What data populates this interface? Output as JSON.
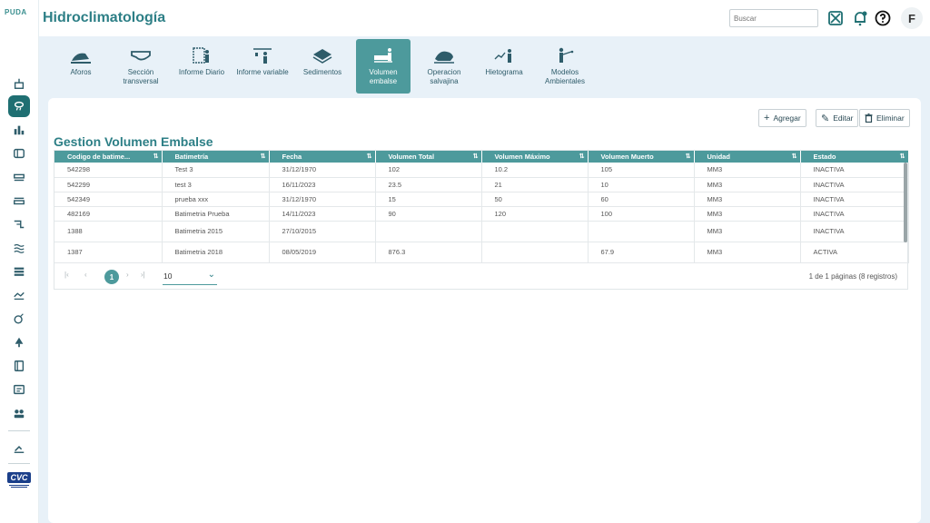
{
  "brand": {
    "logo_text": "PUDA",
    "cvc_text": "CVC"
  },
  "header": {
    "title": "Hidroclimatología",
    "search_placeholder": "Buscar",
    "user_initial": "F"
  },
  "modules": [
    {
      "label": "Aforos",
      "icon": "aforos-icon",
      "active": false
    },
    {
      "label": "Sección transversal",
      "icon": "cross-section-icon",
      "active": false
    },
    {
      "label": "Informe Diario",
      "icon": "daily-report-icon",
      "active": false
    },
    {
      "label": "Informe variable",
      "icon": "variable-report-icon",
      "active": false
    },
    {
      "label": "Sedimentos",
      "icon": "sediments-icon",
      "active": false
    },
    {
      "label": "Volumen embalse",
      "icon": "reservoir-volume-icon",
      "active": true
    },
    {
      "label": "Operacion salvajina",
      "icon": "salvajina-icon",
      "active": false
    },
    {
      "label": "Hietograma",
      "icon": "hyetogram-icon",
      "active": false
    },
    {
      "label": "Modelos Ambientales",
      "icon": "environmental-models-icon",
      "active": false
    }
  ],
  "toolbar": {
    "add_label": "Agregar",
    "edit_label": "Editar",
    "delete_label": "Eliminar"
  },
  "page": {
    "title": "Gestion Volumen Embalse"
  },
  "table": {
    "columns": [
      "Codigo de batime...",
      "Batimetría",
      "Fecha",
      "Volumen Total",
      "Volumen Máximo",
      "Volumen Muerto",
      "Unidad",
      "Estado"
    ],
    "rows": [
      [
        "542298",
        "Test 3",
        "31/12/1970",
        "102",
        "10.2",
        "105",
        "MM3",
        "INACTIVA"
      ],
      [
        "542299",
        "test 3",
        "16/11/2023",
        "23.5",
        "21",
        "10",
        "MM3",
        "INACTIVA"
      ],
      [
        "542349",
        "prueba xxx",
        "31/12/1970",
        "15",
        "50",
        "60",
        "MM3",
        "INACTIVA"
      ],
      [
        "482169",
        "Batimetria Prueba",
        "14/11/2023",
        "90",
        "120",
        "100",
        "MM3",
        "INACTIVA"
      ],
      [
        "1388",
        "Batimetria 2015",
        "27/10/2015",
        "",
        "",
        "",
        "MM3",
        "INACTIVA"
      ],
      [
        "1387",
        "Batimetria 2018",
        "08/05/2019",
        "876.3",
        "",
        "67.9",
        "MM3",
        "ACTIVA"
      ]
    ]
  },
  "pagination": {
    "current_page": "1",
    "page_size": "10",
    "info": "1 de 1 páginas (8 registros)"
  },
  "colors": {
    "accent": "#4d9a9c",
    "title": "#2d7f86",
    "active_side": "#1f6f72",
    "background": "#e8f1f8"
  }
}
